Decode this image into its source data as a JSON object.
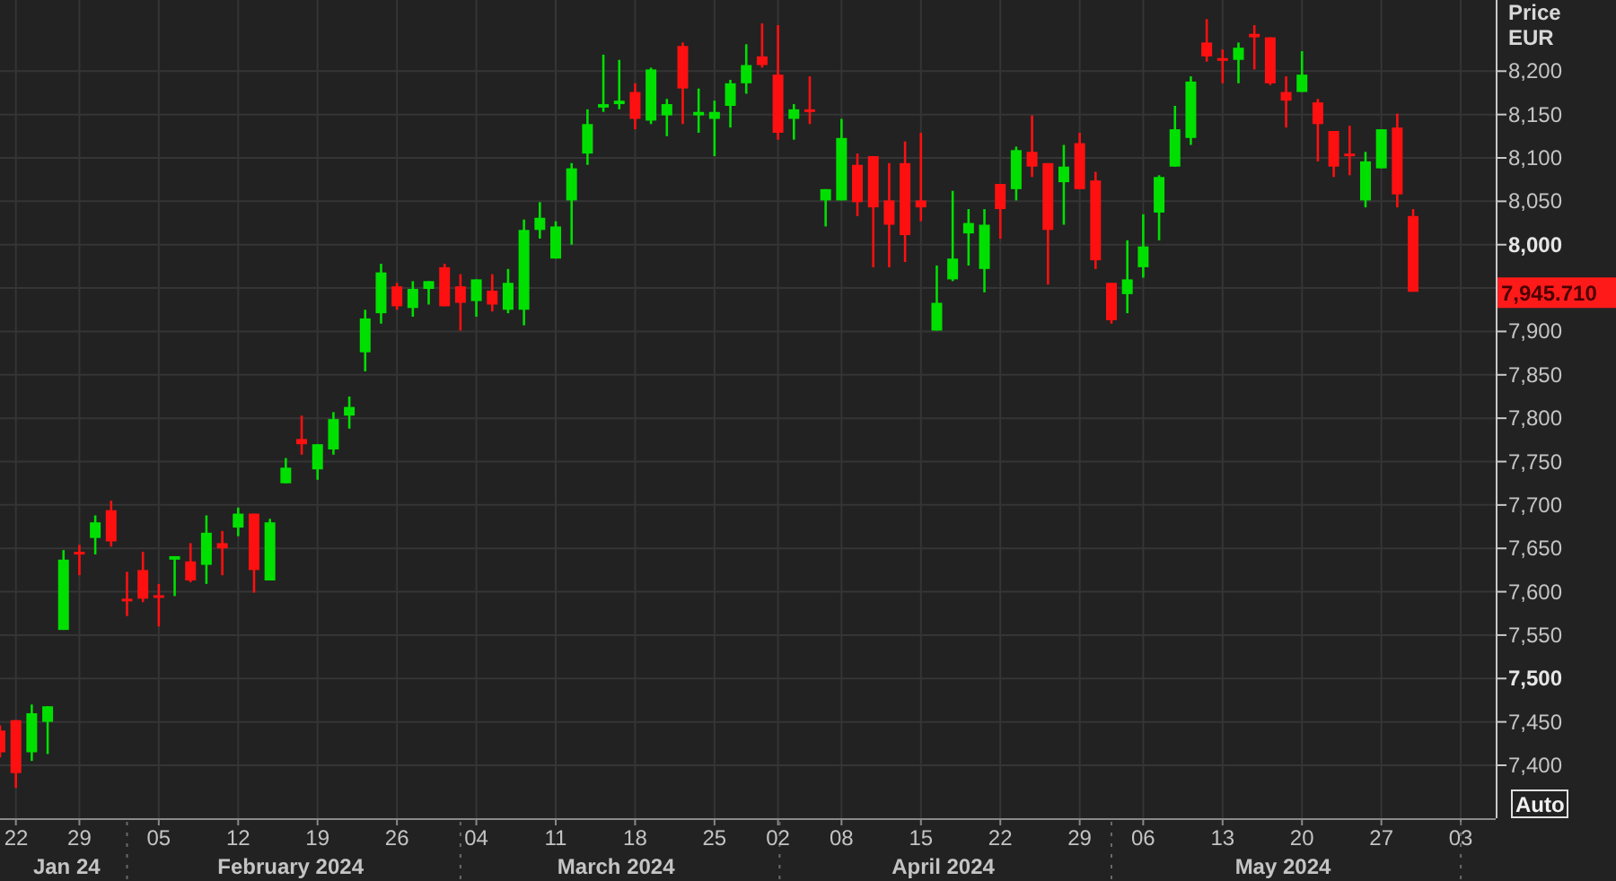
{
  "chart": {
    "currency": "EUR",
    "auto_button": "Auto",
    "months": [
      "Jan 24",
      "February 2024",
      "March 2024",
      "April 2024",
      "May 2024"
    ],
    "chart_data": {
      "type": "candlestick",
      "ylabel": "Price",
      "grid": true,
      "ylim": [
        7339,
        8282
      ],
      "categories": [
        null,
        "22",
        null,
        null,
        null,
        "29",
        null,
        null,
        null,
        null,
        "05",
        null,
        null,
        null,
        null,
        "12",
        null,
        null,
        null,
        null,
        "19",
        null,
        null,
        null,
        null,
        "26",
        null,
        null,
        null,
        null,
        "04",
        null,
        null,
        null,
        null,
        "11",
        null,
        null,
        null,
        null,
        "18",
        null,
        null,
        null,
        null,
        "25",
        null,
        null,
        null,
        "02",
        null,
        null,
        null,
        "08",
        null,
        null,
        null,
        null,
        "15",
        null,
        null,
        null,
        null,
        "22",
        null,
        null,
        null,
        null,
        "29",
        null,
        null,
        null,
        "06",
        null,
        null,
        null,
        null,
        "13",
        null,
        null,
        null,
        null,
        "20",
        null,
        null,
        null,
        null,
        "27",
        null,
        null,
        null,
        null,
        "03"
      ],
      "ohlc": [
        [
          7440,
          7446,
          7409,
          7415
        ],
        [
          7452,
          7452,
          7374,
          7391
        ],
        [
          7415,
          7470,
          7405,
          7460
        ],
        [
          7450,
          7468,
          7413,
          7468
        ],
        [
          7556,
          7648,
          7556,
          7637
        ],
        [
          7646,
          7654,
          7619,
          7643
        ],
        [
          7662,
          7688,
          7643,
          7680
        ],
        [
          7694,
          7705,
          7652,
          7658
        ],
        [
          7592,
          7623,
          7572,
          7590
        ],
        [
          7625,
          7646,
          7588,
          7592
        ],
        [
          7596,
          7609,
          7560,
          7593
        ],
        [
          7637,
          7641,
          7595,
          7641
        ],
        [
          7635,
          7656,
          7611,
          7613
        ],
        [
          7631,
          7688,
          7609,
          7668
        ],
        [
          7656,
          7670,
          7619,
          7650
        ],
        [
          7674,
          7697,
          7664,
          7690
        ],
        [
          7690,
          7690,
          7599,
          7625
        ],
        [
          7613,
          7684,
          7613,
          7680
        ],
        [
          7725,
          7754,
          7725,
          7743
        ],
        [
          7776,
          7803,
          7758,
          7770
        ],
        [
          7741,
          7770,
          7729,
          7770
        ],
        [
          7764,
          7807,
          7758,
          7799
        ],
        [
          7803,
          7825,
          7788,
          7813
        ],
        [
          7876,
          7925,
          7854,
          7915
        ],
        [
          7921,
          7978,
          7909,
          7968
        ],
        [
          7952,
          7956,
          7925,
          7929
        ],
        [
          7927,
          7958,
          7917,
          7949
        ],
        [
          7949,
          7958,
          7931,
          7958
        ],
        [
          7974,
          7978,
          7929,
          7929
        ],
        [
          7952,
          7966,
          7901,
          7933
        ],
        [
          7935,
          7960,
          7917,
          7960
        ],
        [
          7947,
          7966,
          7923,
          7931
        ],
        [
          7925,
          7972,
          7921,
          7956
        ],
        [
          7925,
          8029,
          7907,
          8017
        ],
        [
          8017,
          8049,
          8007,
          8031
        ],
        [
          7984,
          8027,
          7984,
          8021
        ],
        [
          8051,
          8094,
          8000,
          8088
        ],
        [
          8105,
          8156,
          8092,
          8139
        ],
        [
          8158,
          8219,
          8153,
          8162
        ],
        [
          8162,
          8213,
          8156,
          8166
        ],
        [
          8176,
          8186,
          8133,
          8145
        ],
        [
          8143,
          8204,
          8139,
          8202
        ],
        [
          8149,
          8168,
          8125,
          8162
        ],
        [
          8229,
          8233,
          8139,
          8180
        ],
        [
          8149,
          8180,
          8129,
          8153
        ],
        [
          8145,
          8166,
          8102,
          8153
        ],
        [
          8160,
          8190,
          8135,
          8186
        ],
        [
          8186,
          8231,
          8174,
          8207
        ],
        [
          8217,
          8255,
          8204,
          8207
        ],
        [
          8196,
          8253,
          8121,
          8129
        ],
        [
          8145,
          8162,
          8121,
          8156
        ],
        [
          8156,
          8194,
          8139,
          8153
        ],
        [
          8051,
          8064,
          8021,
          8064
        ],
        [
          8051,
          8145,
          8051,
          8123
        ],
        [
          8092,
          8105,
          8033,
          8049
        ],
        [
          8102,
          8102,
          7974,
          8043
        ],
        [
          8051,
          8094,
          7974,
          8023
        ],
        [
          8094,
          8119,
          7980,
          8011
        ],
        [
          8051,
          8129,
          8027,
          8043
        ],
        [
          7901,
          7976,
          7901,
          7933
        ],
        [
          7960,
          8062,
          7958,
          7984
        ],
        [
          8013,
          8041,
          7976,
          8025
        ],
        [
          7972,
          8041,
          7945,
          8023
        ],
        [
          8070,
          8070,
          8007,
          8041
        ],
        [
          8064,
          8113,
          8051,
          8109
        ],
        [
          8107,
          8149,
          8078,
          8090
        ],
        [
          8094,
          8094,
          7954,
          8017
        ],
        [
          8072,
          8115,
          8023,
          8090
        ],
        [
          8117,
          8129,
          8064,
          8064
        ],
        [
          8074,
          8084,
          7972,
          7982
        ],
        [
          7956,
          7956,
          7909,
          7913
        ],
        [
          7943,
          8005,
          7921,
          7960
        ],
        [
          7974,
          8035,
          7962,
          7998
        ],
        [
          8037,
          8080,
          8005,
          8078
        ],
        [
          8090,
          8160,
          8090,
          8133
        ],
        [
          8123,
          8194,
          8115,
          8188
        ],
        [
          8233,
          8260,
          8211,
          8217
        ],
        [
          8215,
          8225,
          8186,
          8213
        ],
        [
          8213,
          8233,
          8186,
          8227
        ],
        [
          8243,
          8253,
          8202,
          8239
        ],
        [
          8239,
          8239,
          8184,
          8186
        ],
        [
          8176,
          8194,
          8135,
          8166
        ],
        [
          8176,
          8223,
          8176,
          8196
        ],
        [
          8164,
          8168,
          8096,
          8139
        ],
        [
          8131,
          8131,
          8078,
          8090
        ],
        [
          8105,
          8137,
          8080,
          8102
        ],
        [
          8051,
          8107,
          8043,
          8096
        ],
        [
          8088,
          8133,
          8088,
          8133
        ],
        [
          8135,
          8151,
          8043,
          8058
        ],
        [
          8033,
          8041,
          7945.71,
          7945.71
        ],
        null,
        null,
        null
      ],
      "yticks": [
        {
          "value": 7400,
          "label": "7,400"
        },
        {
          "value": 7450,
          "label": "7,450"
        },
        {
          "value": 7500,
          "label": "7,500"
        },
        {
          "value": 7550,
          "label": "7,550"
        },
        {
          "value": 7600,
          "label": "7,600"
        },
        {
          "value": 7650,
          "label": "7,650"
        },
        {
          "value": 7700,
          "label": "7,700"
        },
        {
          "value": 7750,
          "label": "7,750"
        },
        {
          "value": 7800,
          "label": "7,800"
        },
        {
          "value": 7850,
          "label": "7,850"
        },
        {
          "value": 7900,
          "label": "7,900"
        },
        {
          "value": 8000,
          "label": "8,000"
        },
        {
          "value": 8050,
          "label": "8,050"
        },
        {
          "value": 8100,
          "label": "8,100"
        },
        {
          "value": 8150,
          "label": "8,150"
        },
        {
          "value": 8200,
          "label": "8,200"
        }
      ],
      "annotations": [
        "7,945.710"
      ]
    }
  }
}
